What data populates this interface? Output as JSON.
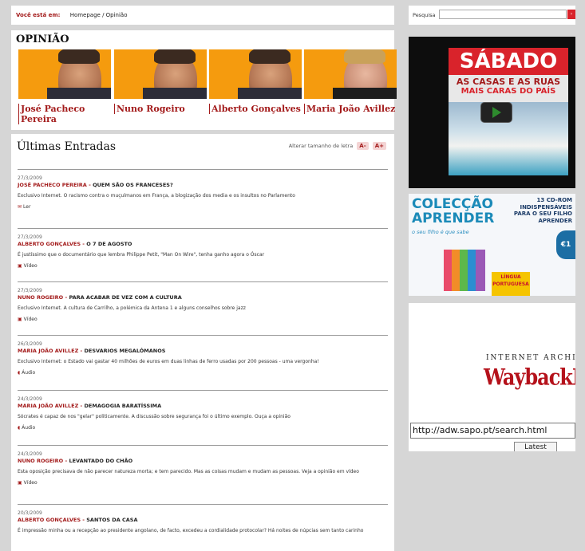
{
  "breadcrumb": {
    "label": "Você está em:",
    "path": "Homepage / Opinião"
  },
  "opinion": {
    "title": "OPINIÃO",
    "columnists": [
      {
        "name": "José Pacheco Pereira"
      },
      {
        "name": "Nuno Rogeiro"
      },
      {
        "name": "Alberto Gonçalves"
      },
      {
        "name": "Maria João Avillez"
      }
    ]
  },
  "latest": {
    "title": "Últimas Entradas",
    "font_size_label": "Alterar tamanho de letra",
    "font_minus": "A-",
    "font_plus": "A+",
    "entries": [
      {
        "date": "27/3/2009",
        "author": "JOSÉ PACHECO PEREIRA",
        "title": "QUEM SÃO OS FRANCESES?",
        "desc": "Exclusivo Internet. O racismo contra o muçulmanos em França, a blogização dos media e os insultos no Parlamento",
        "media": "Ler"
      },
      {
        "date": "27/3/2009",
        "author": "ALBERTO GONÇALVES",
        "title": "O 7 DE AGOSTO",
        "desc": "É justíssimo que o documentário que lembra Philippe Petit, \"Man On Wire\", tenha ganho agora o Óscar",
        "media": "Vídeo"
      },
      {
        "date": "27/3/2009",
        "author": "NUNO ROGEIRO",
        "title": "PARA ACABAR DE VEZ COM A CULTURA",
        "desc": "Exclusivo Internet. A cultura de Carrilho, a polémica da Antena 1 e alguns conselhos sobre jazz",
        "media": "Vídeo"
      },
      {
        "date": "26/3/2009",
        "author": "MARIA JOÃO AVILLEZ",
        "title": "DESVARIOS MEGALÓMANOS",
        "desc": "Exclusivo Internet: o Estado vai gastar 40 milhões de euros em duas linhas de ferro usadas por 200 pessoas - uma vergonha!",
        "media": "Áudio"
      },
      {
        "date": "24/3/2009",
        "author": "MARIA JOÃO AVILLEZ",
        "title": "DEMAGOGIA BARATÍSSIMA",
        "desc": "Sócrates é capaz de nos \"gelar\" politicamente. A discussão sobre segurança foi o último exemplo. Ouça a opinião",
        "media": "Áudio"
      },
      {
        "date": "24/3/2009",
        "author": "NUNO ROGEIRO",
        "title": "LEVANTADO DO CHÃO",
        "desc": "Esta oposição precisava de não parecer natureza morta; e tem parecido. Mas as coisas mudam e mudam as pessoas. Veja a opinião em vídeo",
        "media": "Vídeo"
      },
      {
        "date": "20/3/2009",
        "author": "ALBERTO GONÇALVES",
        "title": "SANTOS DA CASA",
        "desc": "É impressão minha ou a recepção ao presidente angolano, de facto, excedeu a cordialidade protocolar? Há noites de núpcias sem tanto carinho",
        "media": ""
      }
    ]
  },
  "sidebar": {
    "search_label": "Pesquisa",
    "search_value": "",
    "video": {
      "brand": "SÁBADO",
      "headline1": "AS CASAS E AS RUAS",
      "headline2": "MAIS CARAS DO PAÍS"
    },
    "ad": {
      "title1": "COLECÇÃO",
      "title2": "APRENDER",
      "tagline": "o seu filho é que sabe",
      "right_text": "13 CD-ROM INDISPENSÁVEIS PARA O SEU FILHO APRENDER",
      "book": "LÍNGUA PORTUGUESA",
      "badge": "€1"
    },
    "wayback": {
      "line1": "INTERNET ARCHIVE",
      "line2": "WaybackMachine",
      "url": "http://adw.sapo.pt/search.html",
      "button": "Latest"
    }
  },
  "colors": {
    "accent": "#a31b1b",
    "photo_bg": "#f59b0e",
    "ad_blue": "#1b8ab8"
  }
}
